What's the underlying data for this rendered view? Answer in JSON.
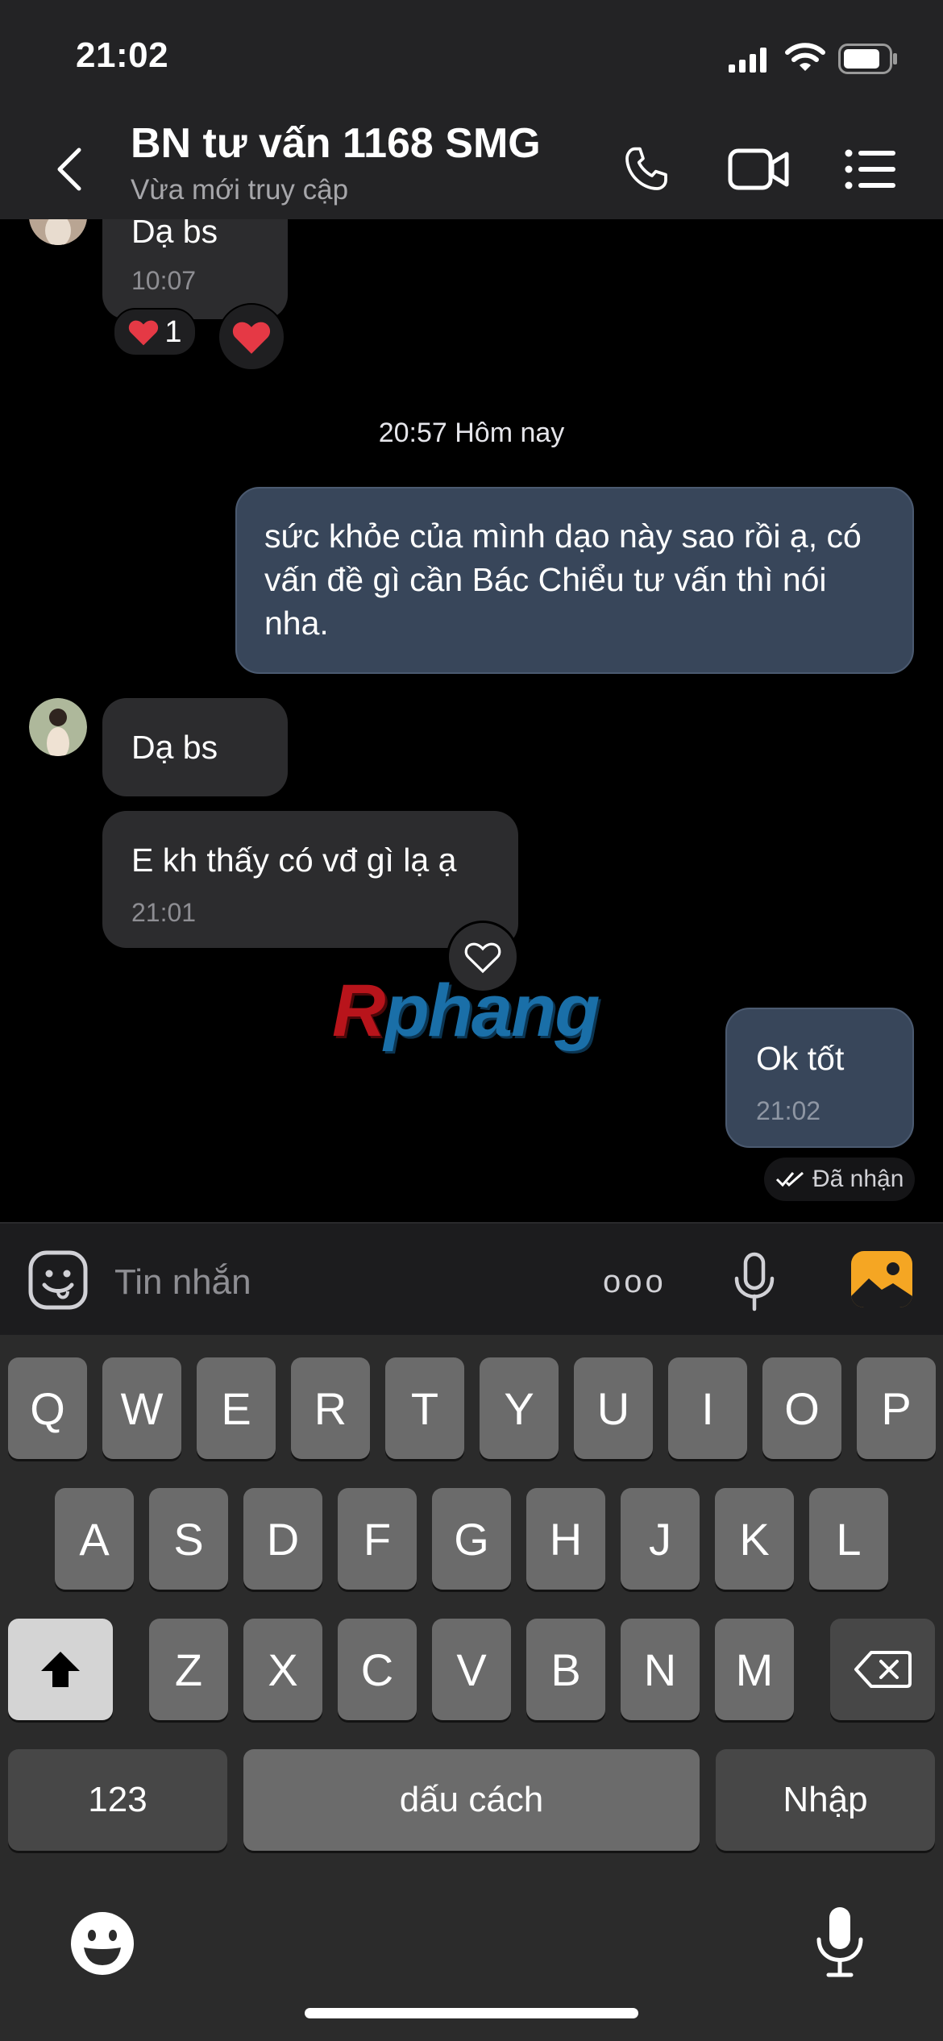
{
  "status_bar": {
    "time": "21:02"
  },
  "header": {
    "title": "BN tư vấn 1168 SMG",
    "subtitle": "Vừa mới truy cập",
    "icons": [
      "back-icon",
      "phone-icon",
      "video-call-icon",
      "list-menu-icon"
    ]
  },
  "chat": {
    "prev_message": {
      "text": "Dạ bs",
      "time": "10:07",
      "reaction_count": "1"
    },
    "date_separator": "20:57 Hôm nay",
    "outgoing_1": {
      "text": "sức khỏe của mình dạo này sao rồi ạ, có vấn đề gì cần Bác Chiểu tư vấn thì nói nha."
    },
    "incoming_1": {
      "text": "Dạ bs"
    },
    "incoming_2": {
      "text": "E kh thấy có vđ gì lạ ạ",
      "time": "21:01"
    },
    "watermark": "Rphang",
    "outgoing_2": {
      "text": "Ok tốt",
      "time": "21:02",
      "status": "Đã nhận"
    }
  },
  "input": {
    "placeholder": "Tin nhắn",
    "more_label": "ooo"
  },
  "keyboard": {
    "row1": [
      "Q",
      "W",
      "E",
      "R",
      "T",
      "Y",
      "U",
      "I",
      "O",
      "P"
    ],
    "row2": [
      "A",
      "S",
      "D",
      "F",
      "G",
      "H",
      "J",
      "K",
      "L"
    ],
    "row3": [
      "Z",
      "X",
      "C",
      "V",
      "B",
      "N",
      "M"
    ],
    "numbers_key": "123",
    "space_key": "dấu cách",
    "return_key": "Nhập"
  },
  "colors": {
    "header_bg": "#232325",
    "incoming_bubble": "#2c2c2e",
    "outgoing_bubble": "#38465a",
    "photo_icon": "#f5a623",
    "heart": "#e53945"
  }
}
